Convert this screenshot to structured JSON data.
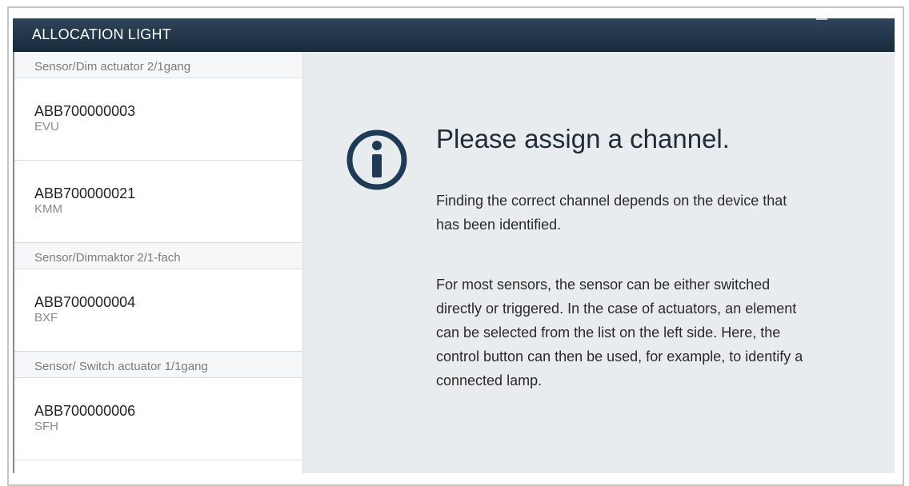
{
  "window": {
    "title": "ALLOCATION LIGHT"
  },
  "sidebar": {
    "groups": [
      {
        "header": "Sensor/Dim actuator 2/1gang",
        "devices": [
          {
            "id": "ABB700000003",
            "sub": "EVU"
          },
          {
            "id": "ABB700000021",
            "sub": "KMM"
          }
        ]
      },
      {
        "header": "Sensor/Dimmaktor 2/1-fach",
        "devices": [
          {
            "id": "ABB700000004",
            "sub": "BXF"
          }
        ]
      },
      {
        "header": "Sensor/ Switch actuator 1/1gang",
        "devices": [
          {
            "id": "ABB700000006",
            "sub": "SFH"
          }
        ]
      }
    ]
  },
  "main": {
    "icon": "info-icon",
    "heading": "Please assign a channel.",
    "paragraph1": "Finding the correct channel depends on the device that has been identified.",
    "paragraph2": "For most sensors, the sensor can be either switched directly or triggered. In the case of actuators, an element can be selected from the list on the left side. Here, the control button can then be used, for example, to identify a connected lamp."
  },
  "colors": {
    "titlebar": "#1f3347",
    "main_background": "#e9ecee",
    "icon": "#1e3a55"
  }
}
